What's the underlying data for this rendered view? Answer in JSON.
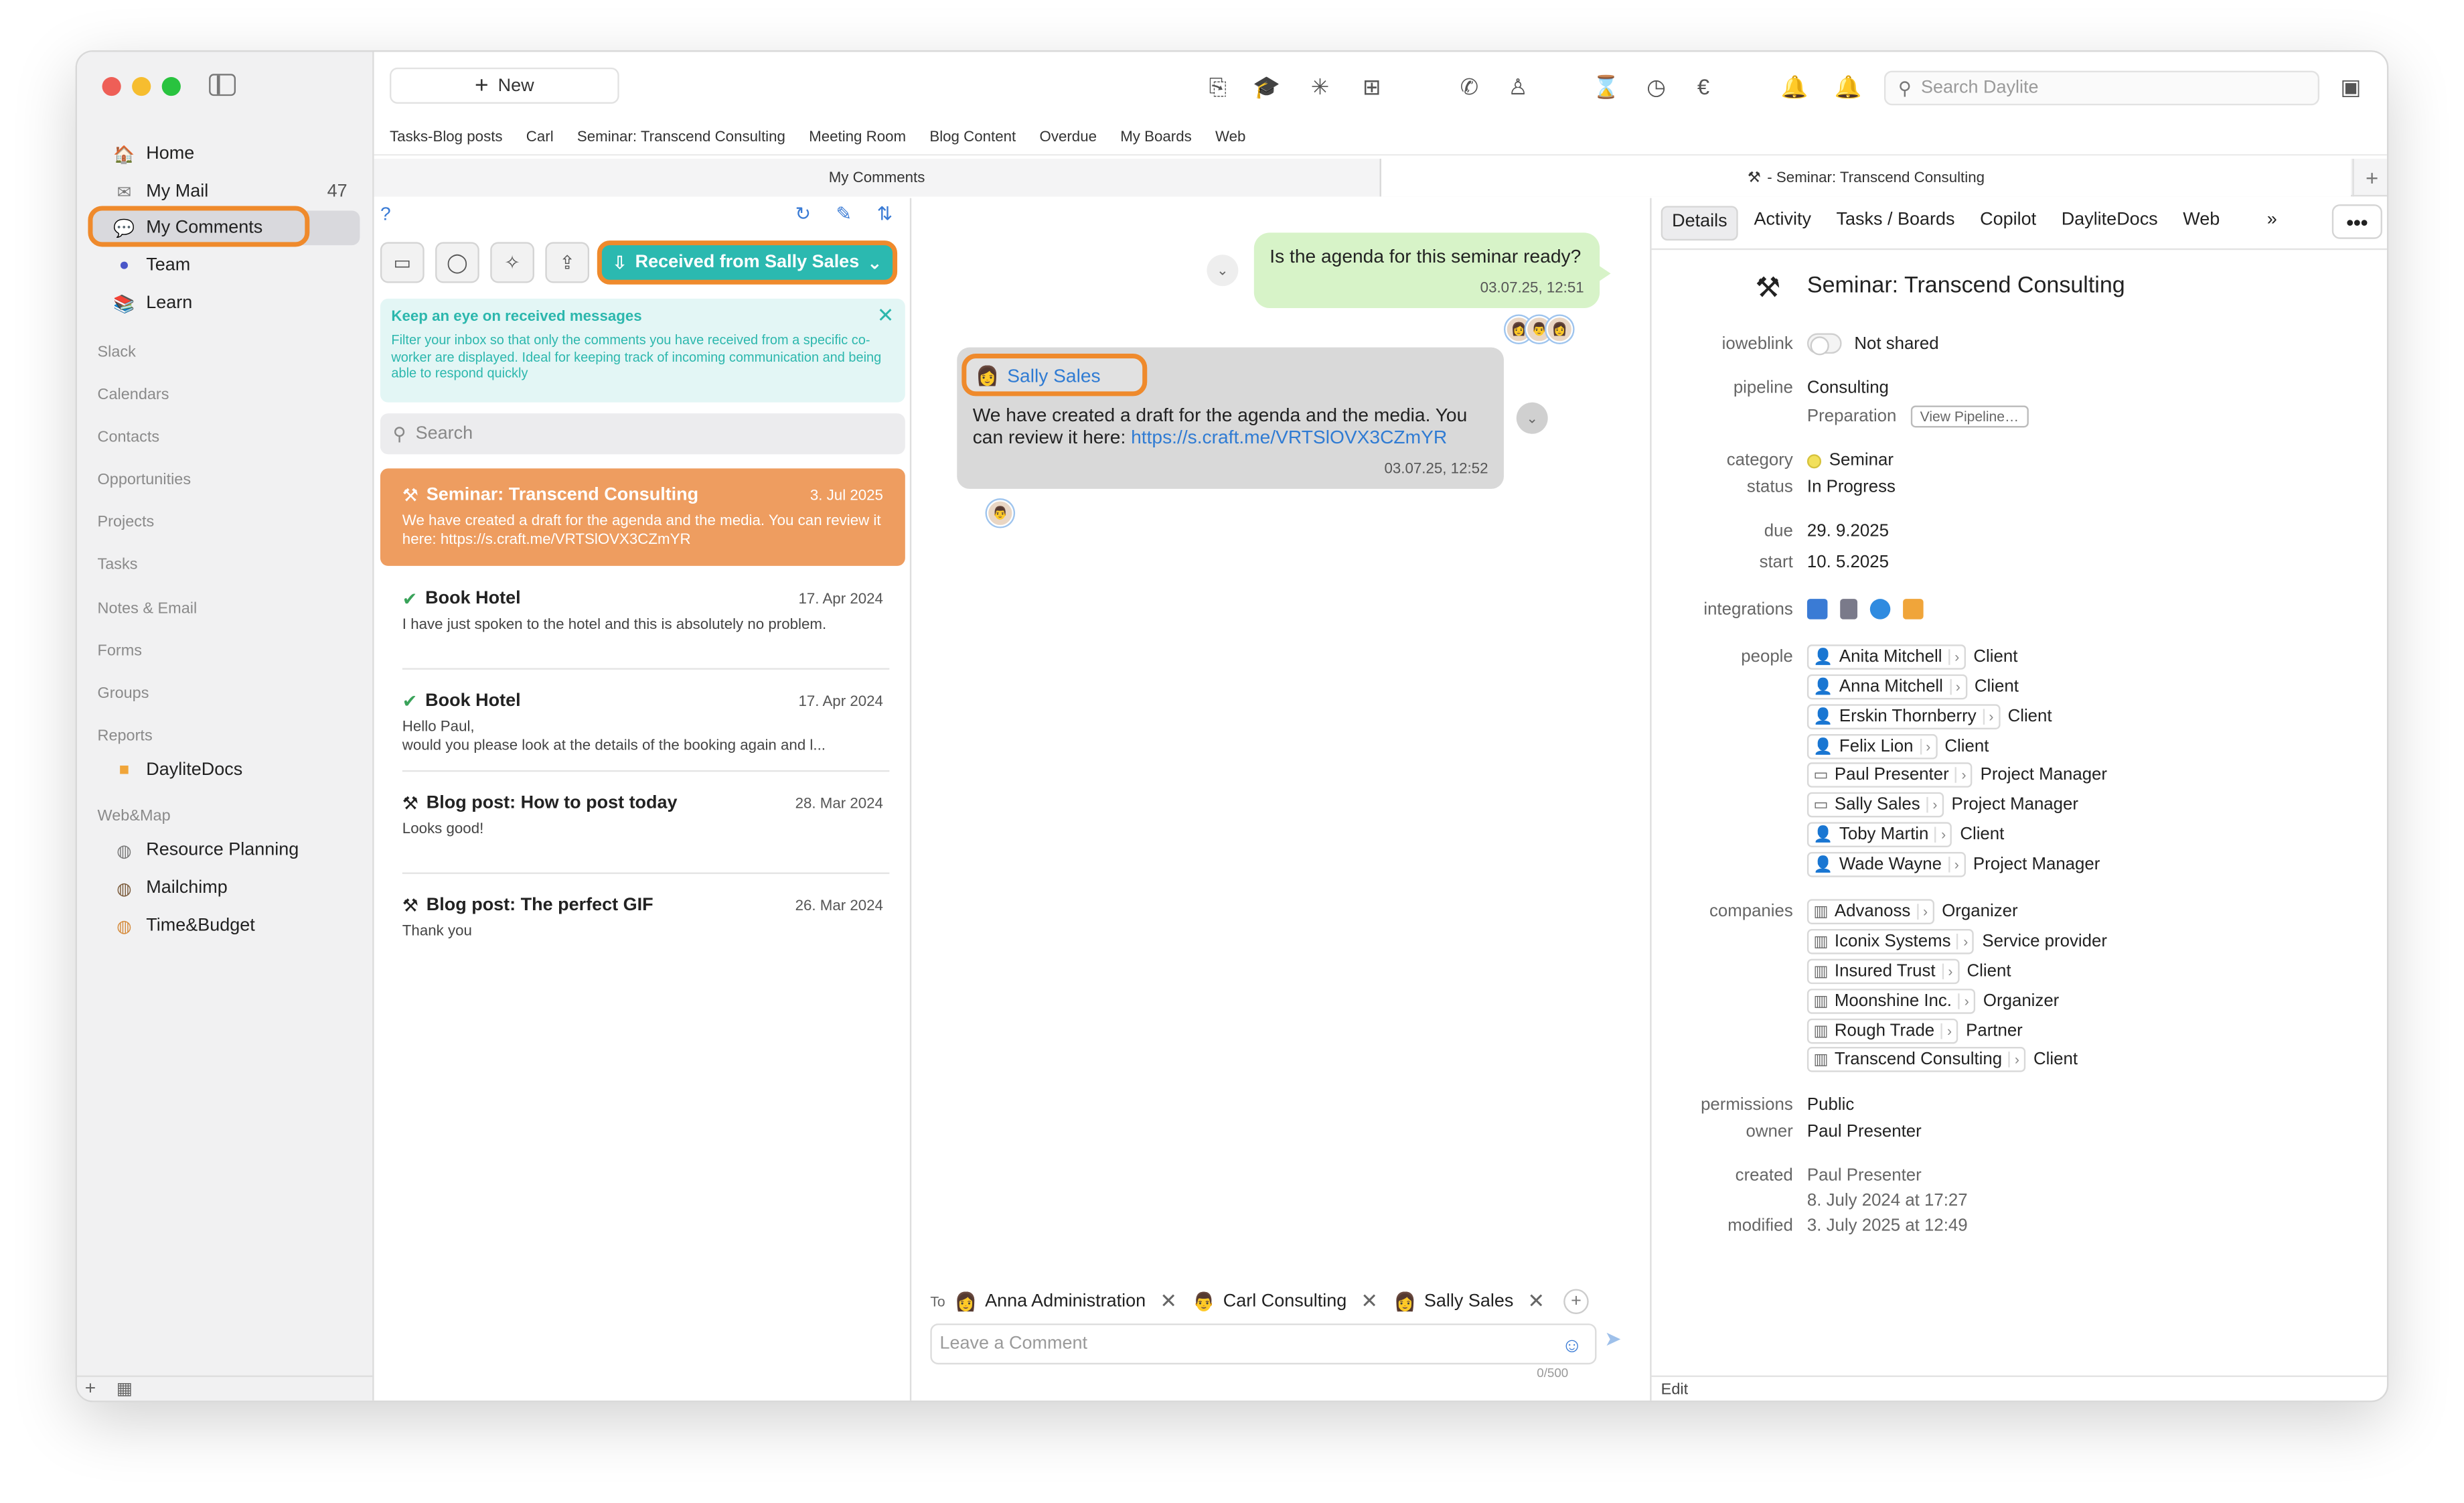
{
  "sidebar": {
    "nav": [
      {
        "label": "Home",
        "icon": "house-icon"
      },
      {
        "label": "My Mail",
        "count": "47",
        "icon": "envelope-icon"
      },
      {
        "label": "My Comments",
        "icon": "comments-icon"
      },
      {
        "label": "Team",
        "icon": "team-icon"
      },
      {
        "label": "Learn",
        "icon": "books-icon"
      }
    ],
    "sections": [
      "Slack",
      "Calendars",
      "Contacts",
      "Opportunities",
      "Projects",
      "Tasks",
      "Notes & Email",
      "Forms",
      "Groups",
      "Reports"
    ],
    "reports_items": [
      {
        "label": "DayliteDocs",
        "icon": "folder-icon"
      }
    ],
    "webmap_title": "Web&Map",
    "webmap_items": [
      {
        "label": "Resource Planning",
        "icon": "globe-icon"
      },
      {
        "label": "Mailchimp",
        "icon": "mailchimp-icon"
      },
      {
        "label": "Time&Budget",
        "icon": "clock-icon"
      }
    ],
    "bottom": {
      "add": "+",
      "calendar": "▦"
    }
  },
  "toolbar": {
    "new_label": "New",
    "search_placeholder": "Search Daylite"
  },
  "quick_tabs": [
    "Tasks-Blog posts",
    "Carl",
    "Seminar: Transcend Consulting",
    "Meeting Room",
    "Blog Content",
    "Overdue",
    "My Boards",
    "Web"
  ],
  "doc_tabs": {
    "left": "My Comments",
    "right": "- Seminar: Transcend Consulting",
    "plus": "+"
  },
  "list": {
    "help": "?",
    "received_label": "Received from Sally Sales",
    "info_title": "Keep an eye on received messages",
    "info_body": "Filter your inbox so that only the comments you have received from a specific co-worker are displayed. Ideal for keeping track of incoming communication and being able to respond quickly",
    "search_placeholder": "Search",
    "items": [
      {
        "title": "Seminar: Transcend Consulting",
        "date": "3. Jul 2025",
        "preview": "We have created a draft for the agenda and the media. You can review it here: https://s.craft.me/VRTSlOVX3CZmYR",
        "icon": "hammer-icon",
        "selected": true
      },
      {
        "title": "Book Hotel",
        "date": "17. Apr 2024",
        "preview": "I have just spoken to the hotel and this is absolutely no problem.",
        "icon": "check-icon",
        "selected": false
      },
      {
        "title": "Book Hotel",
        "date": "17. Apr 2024",
        "preview": "Hello Paul,\nwould you please look at the details of the booking again and l...",
        "icon": "check-icon",
        "selected": false
      },
      {
        "title": "Blog post: How to post today",
        "date": "28. Mar 2024",
        "preview": "Looks good!",
        "icon": "hammer-icon",
        "selected": false
      },
      {
        "title": "Blog post: The perfect GIF",
        "date": "26. Mar 2024",
        "preview": "Thank you",
        "icon": "hammer-icon",
        "selected": false
      }
    ]
  },
  "chat": {
    "outgoing": {
      "text": "Is the agenda for this seminar ready?",
      "time": "03.07.25, 12:51"
    },
    "incoming": {
      "sender": "Sally Sales",
      "text": "We have created a draft for the agenda and the media. You can review it here: ",
      "link": "https://s.craft.me/VRTSlOVX3CZmYR",
      "time": "03.07.25, 12:52"
    },
    "to_label": "To",
    "recipients": [
      "Anna Administration",
      "Carl Consulting",
      "Sally Sales"
    ],
    "comment_placeholder": "Leave a Comment",
    "counter": "0/500"
  },
  "details": {
    "tabs": [
      "Details",
      "Activity",
      "Tasks / Boards",
      "Copilot",
      "DayliteDocs",
      "Web"
    ],
    "more_tabs": "»",
    "more": "•••",
    "title": "Seminar: Transcend Consulting",
    "fields": {
      "ioweblink_label": "ioweblink",
      "ioweblink_value": "Not shared",
      "pipeline_label": "pipeline",
      "pipeline_value": "Consulting",
      "pipeline_stage": "Preparation",
      "view_pipeline": "View Pipeline…",
      "category_label": "category",
      "category_value": "Seminar",
      "status_label": "status",
      "status_value": "In Progress",
      "due_label": "due",
      "due_value": "29. 9.2025",
      "start_label": "start",
      "start_value": "10. 5.2025",
      "integrations_label": "integrations",
      "people_label": "people",
      "companies_label": "companies",
      "permissions_label": "permissions",
      "permissions_value": "Public",
      "owner_label": "owner",
      "owner_value": "Paul Presenter",
      "created_label": "created",
      "created_by": "Paul Presenter",
      "created_at": "8. July 2024 at 17:27",
      "modified_label": "modified",
      "modified_at": "3. July 2025 at 12:49"
    },
    "people": [
      {
        "name": "Anita Mitchell",
        "role": "Client",
        "icon": "person-icon"
      },
      {
        "name": "Anna Mitchell",
        "role": "Client",
        "icon": "person-icon"
      },
      {
        "name": "Erskin Thornberry",
        "role": "Client",
        "icon": "person-icon"
      },
      {
        "name": "Felix Lion",
        "role": "Client",
        "icon": "person-icon"
      },
      {
        "name": "Paul Presenter",
        "role": "Project Manager",
        "icon": "id-card-icon"
      },
      {
        "name": "Sally Sales",
        "role": "Project Manager",
        "icon": "id-card-icon"
      },
      {
        "name": "Toby Martin",
        "role": "Client",
        "icon": "person-icon"
      },
      {
        "name": "Wade Wayne",
        "role": "Project Manager",
        "icon": "person-icon"
      }
    ],
    "companies": [
      {
        "name": "Advanoss",
        "role": "Organizer"
      },
      {
        "name": "Iconix Systems",
        "role": "Service provider"
      },
      {
        "name": "Insured Trust",
        "role": "Client"
      },
      {
        "name": "Moonshine Inc.",
        "role": "Organizer"
      },
      {
        "name": "Rough Trade",
        "role": "Partner"
      },
      {
        "name": "Transcend Consulting",
        "role": "Client"
      }
    ],
    "edit": "Edit"
  },
  "colors": {
    "accent": "#2bb9b0",
    "highlight": "#ef8a2c",
    "selected_row": "#ee9d60",
    "outgoing_bubble": "#d7f3c8",
    "link": "#2f7bd3"
  }
}
